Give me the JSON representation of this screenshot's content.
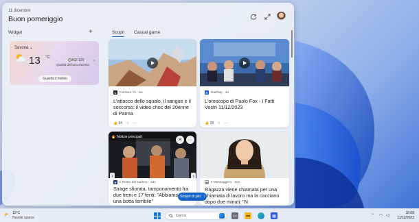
{
  "header": {
    "date": "11 dicembre",
    "greeting": "Buon pomeriggio"
  },
  "sections": {
    "widget_label": "Widget",
    "add_label": "+",
    "tabs": [
      {
        "label": "Scopri",
        "active": true
      },
      {
        "label": "Casual game",
        "active": false
      }
    ]
  },
  "weather": {
    "city": "Savona",
    "temperature": "13",
    "unit": "°C",
    "aqi": "AQI 126",
    "quality": "Qualità dell'aria discreta",
    "button": "Guarda il meteo"
  },
  "cards": [
    {
      "source": "Corriere Tv · 5o",
      "title": "L'attacco dello squalo, il sangue e il soccorso: il video choc del 20enne di Parma",
      "likes": "84",
      "has_video": true
    },
    {
      "source": "RaiPlay · 4o",
      "title": "L'oroscopo di Paolo Fox - I Fatti Vostri 11/12/2023",
      "likes": "28",
      "has_video": true
    },
    {
      "overlay_label": "Notizie principali",
      "source": "Il Resto del Carlino · 13o",
      "title": "Strage sfiorata, tamponamento fra due treni e 17 feriti: \"Abbiamo sentito una botta terribile\"",
      "has_video": false
    },
    {
      "source": "Il Messaggero · 22o",
      "title": "Ragazza viene chiamata per una chiamata di lavoro ma la cacciano dopo due minuti: \"N",
      "has_video": false
    }
  ],
  "more_button": "Scopri di più",
  "taskbar": {
    "weather_temp": "13°C",
    "weather_desc": "Nuvole sparse",
    "search_placeholder": "Cerca",
    "time": "18:08",
    "date": "11/12/2023"
  },
  "colors": {
    "accent": "#1a66c9",
    "panel": "#ecf0f8"
  }
}
